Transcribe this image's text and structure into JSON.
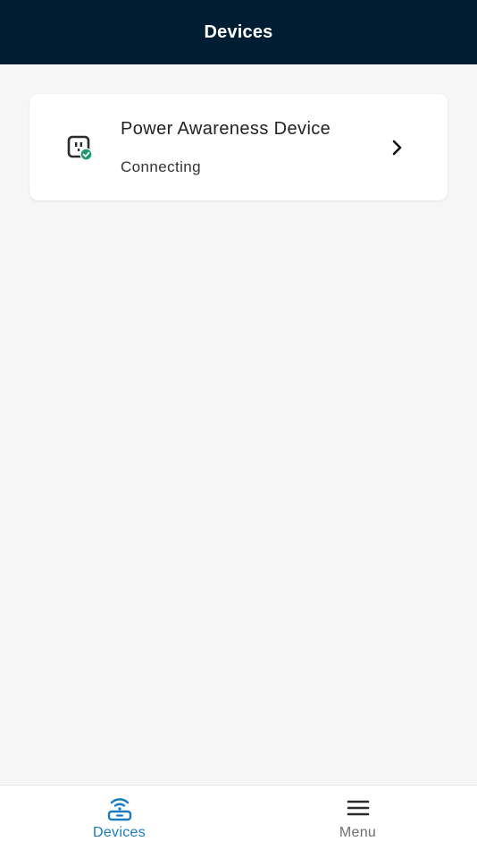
{
  "header": {
    "title": "Devices"
  },
  "devices": [
    {
      "name": "Power Awareness Device",
      "status": "Connecting",
      "icon": "outlet-check-icon"
    }
  ],
  "tabbar": {
    "tabs": [
      {
        "label": "Devices",
        "icon": "router-wifi-icon",
        "active": true
      },
      {
        "label": "Menu",
        "icon": "hamburger-menu-icon",
        "active": false
      }
    ]
  },
  "colors": {
    "header_bg": "#001e33",
    "accent": "#1a7bbf",
    "status_green": "#1a9a6c",
    "background": "#f6f6f6"
  }
}
